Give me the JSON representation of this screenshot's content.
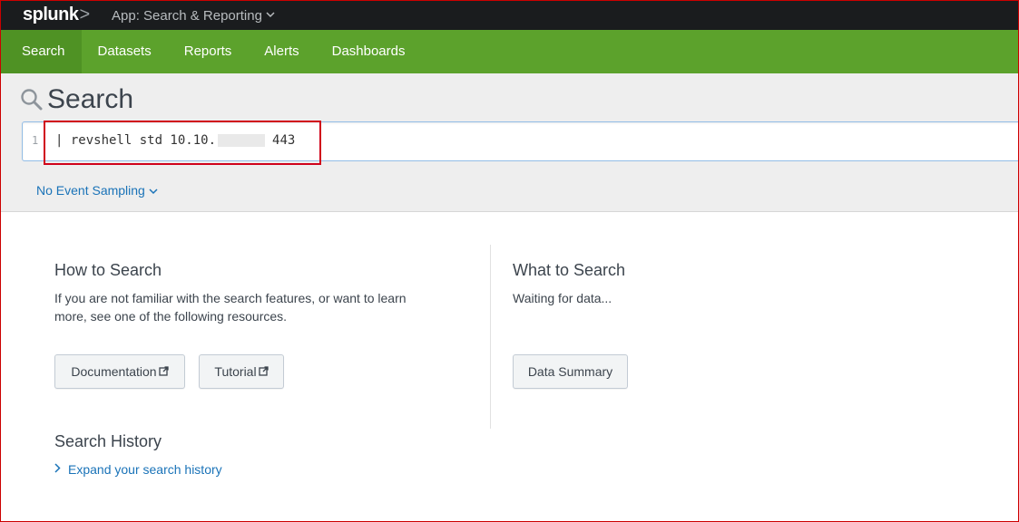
{
  "app": {
    "logo": "splunk",
    "logo_chevron": ">",
    "app_menu_label": "App: Search & Reporting"
  },
  "nav": {
    "items": [
      {
        "label": "Search",
        "active": true
      },
      {
        "label": "Datasets"
      },
      {
        "label": "Reports"
      },
      {
        "label": "Alerts"
      },
      {
        "label": "Dashboards"
      }
    ]
  },
  "search": {
    "title": "Search",
    "line_number": "1",
    "query_prefix": "| revshell std 10.10.",
    "query_suffix": "443",
    "sampling_label": "No Event Sampling"
  },
  "how_to": {
    "heading": "How to Search",
    "body": "If you are not familiar with the search features, or want to learn more, see one of the following resources.",
    "documentation_label": "Documentation",
    "tutorial_label": "Tutorial"
  },
  "what_to": {
    "heading": "What to Search",
    "body": "Waiting for data...",
    "data_summary_label": "Data Summary"
  },
  "history": {
    "heading": "Search History",
    "expand_label": "Expand your search history"
  },
  "colors": {
    "nav_green": "#5ca22c",
    "nav_active": "#4f9224",
    "topbar": "#1a1c1e",
    "link_blue": "#1a73b8",
    "highlight_red": "#d0021b"
  }
}
